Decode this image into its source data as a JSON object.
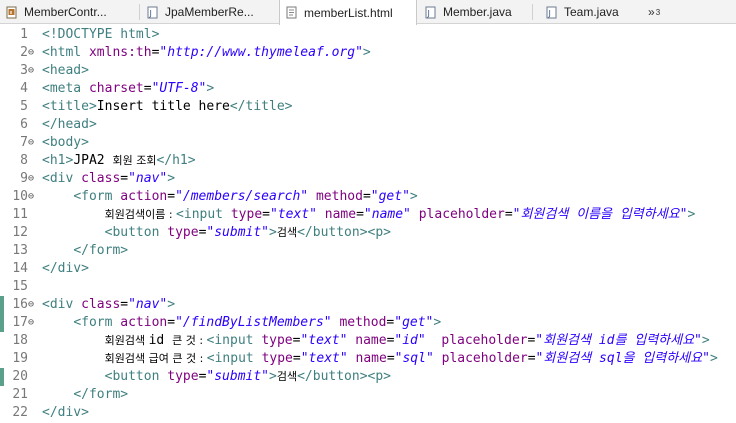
{
  "tabs": [
    {
      "label": "MemberContr...",
      "icon": "java-class-icon",
      "active": false
    },
    {
      "label": "JpaMemberRe...",
      "icon": "java-file-icon",
      "active": false
    },
    {
      "label": "memberList.html",
      "icon": "html-file-icon",
      "active": true
    },
    {
      "label": "Member.java",
      "icon": "java-file-icon",
      "active": false
    },
    {
      "label": "Team.java",
      "icon": "java-file-icon",
      "active": false
    }
  ],
  "overflow": {
    "symbol": "»",
    "count": "3"
  },
  "editor": {
    "lines": [
      {
        "n": "1",
        "fold": "",
        "mark": false,
        "segs": [
          [
            "tg",
            "<!DOCTYPE html>"
          ]
        ]
      },
      {
        "n": "2",
        "fold": "⊖",
        "mark": false,
        "segs": [
          [
            "tg",
            "<html "
          ],
          [
            "at",
            "xmlns:th"
          ],
          [
            "tx",
            "="
          ],
          [
            "av",
            "\"http://www.thymeleaf.org\""
          ],
          [
            "tg",
            ">"
          ]
        ]
      },
      {
        "n": "3",
        "fold": "⊖",
        "mark": false,
        "segs": [
          [
            "tg",
            "<head>"
          ]
        ]
      },
      {
        "n": "4",
        "fold": "",
        "mark": false,
        "segs": [
          [
            "tg",
            "<meta "
          ],
          [
            "at",
            "charset"
          ],
          [
            "tx",
            "="
          ],
          [
            "av",
            "\"UTF-8\""
          ],
          [
            "tg",
            ">"
          ]
        ]
      },
      {
        "n": "5",
        "fold": "",
        "mark": false,
        "segs": [
          [
            "tg",
            "<title>"
          ],
          [
            "tx",
            "Insert title here"
          ],
          [
            "tg",
            "</title>"
          ]
        ]
      },
      {
        "n": "6",
        "fold": "",
        "mark": false,
        "segs": [
          [
            "tg",
            "</head>"
          ]
        ]
      },
      {
        "n": "7",
        "fold": "⊖",
        "mark": false,
        "segs": [
          [
            "tg",
            "<body>"
          ]
        ]
      },
      {
        "n": "8",
        "fold": "",
        "mark": false,
        "segs": [
          [
            "tg",
            "<h1>"
          ],
          [
            "tx",
            "JPA2 "
          ],
          [
            "kr",
            "회원 조회"
          ],
          [
            "tg",
            "</h1>"
          ]
        ]
      },
      {
        "n": "9",
        "fold": "⊖",
        "mark": false,
        "segs": [
          [
            "tg",
            "<div "
          ],
          [
            "at",
            "class"
          ],
          [
            "tx",
            "="
          ],
          [
            "av",
            "\"nav\""
          ],
          [
            "tg",
            ">"
          ]
        ]
      },
      {
        "n": "10",
        "fold": "⊖",
        "mark": false,
        "segs": [
          [
            "tx",
            "    "
          ],
          [
            "tg",
            "<form "
          ],
          [
            "at",
            "action"
          ],
          [
            "tx",
            "="
          ],
          [
            "av",
            "\"/members/search\""
          ],
          [
            "tx",
            " "
          ],
          [
            "at",
            "method"
          ],
          [
            "tx",
            "="
          ],
          [
            "av",
            "\"get\""
          ],
          [
            "tg",
            ">"
          ]
        ]
      },
      {
        "n": "11",
        "fold": "",
        "mark": false,
        "segs": [
          [
            "tx",
            "        "
          ],
          [
            "kr",
            "회원검색이름 : "
          ],
          [
            "tg",
            "<input "
          ],
          [
            "at",
            "type"
          ],
          [
            "tx",
            "="
          ],
          [
            "av",
            "\"text\""
          ],
          [
            "tx",
            " "
          ],
          [
            "at",
            "name"
          ],
          [
            "tx",
            "="
          ],
          [
            "av",
            "\"name\""
          ],
          [
            "tx",
            " "
          ],
          [
            "at",
            "placeholder"
          ],
          [
            "tx",
            "="
          ],
          [
            "av",
            "\"회원검색 이름을 입력하세요\""
          ],
          [
            "tg",
            ">"
          ]
        ]
      },
      {
        "n": "12",
        "fold": "",
        "mark": false,
        "segs": [
          [
            "tx",
            "        "
          ],
          [
            "tg",
            "<button "
          ],
          [
            "at",
            "type"
          ],
          [
            "tx",
            "="
          ],
          [
            "av",
            "\"submit\""
          ],
          [
            "tg",
            ">"
          ],
          [
            "kr",
            "검색"
          ],
          [
            "tg",
            "</button><p>"
          ]
        ]
      },
      {
        "n": "13",
        "fold": "",
        "mark": false,
        "segs": [
          [
            "tx",
            "    "
          ],
          [
            "tg",
            "</form>"
          ]
        ]
      },
      {
        "n": "14",
        "fold": "",
        "mark": false,
        "segs": [
          [
            "tg",
            "</div>"
          ]
        ]
      },
      {
        "n": "15",
        "fold": "",
        "mark": false,
        "segs": []
      },
      {
        "n": "16",
        "fold": "⊖",
        "mark": true,
        "segs": [
          [
            "tg",
            "<div "
          ],
          [
            "at",
            "class"
          ],
          [
            "tx",
            "="
          ],
          [
            "av",
            "\"nav\""
          ],
          [
            "tg",
            ">"
          ]
        ]
      },
      {
        "n": "17",
        "fold": "⊖",
        "mark": true,
        "segs": [
          [
            "tx",
            "    "
          ],
          [
            "tg",
            "<form "
          ],
          [
            "at",
            "action"
          ],
          [
            "tx",
            "="
          ],
          [
            "av",
            "\"/findByListMembers\""
          ],
          [
            "tx",
            " "
          ],
          [
            "at",
            "method"
          ],
          [
            "tx",
            "="
          ],
          [
            "av",
            "\"get\""
          ],
          [
            "tg",
            ">"
          ]
        ]
      },
      {
        "n": "18",
        "fold": "",
        "mark": false,
        "segs": [
          [
            "tx",
            "        "
          ],
          [
            "kr",
            "회원검색 "
          ],
          [
            "tx",
            "id "
          ],
          [
            "kr",
            "큰 것 : "
          ],
          [
            "tg",
            "<input "
          ],
          [
            "at",
            "type"
          ],
          [
            "tx",
            "="
          ],
          [
            "av",
            "\"text\""
          ],
          [
            "tx",
            " "
          ],
          [
            "at",
            "name"
          ],
          [
            "tx",
            "="
          ],
          [
            "av",
            "\"id\""
          ],
          [
            "tx",
            "  "
          ],
          [
            "at",
            "placeholder"
          ],
          [
            "tx",
            "="
          ],
          [
            "av",
            "\"회원검색 id를 입력하세요\""
          ],
          [
            "tg",
            ">"
          ]
        ]
      },
      {
        "n": "19",
        "fold": "",
        "mark": false,
        "segs": [
          [
            "tx",
            "        "
          ],
          [
            "kr",
            "회원검색 급여 큰 것 : "
          ],
          [
            "tg",
            "<input "
          ],
          [
            "at",
            "type"
          ],
          [
            "tx",
            "="
          ],
          [
            "av",
            "\"text\""
          ],
          [
            "tx",
            " "
          ],
          [
            "at",
            "name"
          ],
          [
            "tx",
            "="
          ],
          [
            "av",
            "\"sql\""
          ],
          [
            "tx",
            " "
          ],
          [
            "at",
            "placeholder"
          ],
          [
            "tx",
            "="
          ],
          [
            "av",
            "\"회원검색 sql을 입력하세요\""
          ],
          [
            "tg",
            ">"
          ]
        ]
      },
      {
        "n": "20",
        "fold": "",
        "mark": true,
        "segs": [
          [
            "tx",
            "        "
          ],
          [
            "tg",
            "<button "
          ],
          [
            "at",
            "type"
          ],
          [
            "tx",
            "="
          ],
          [
            "av",
            "\"submit\""
          ],
          [
            "tg",
            ">"
          ],
          [
            "kr",
            "검색"
          ],
          [
            "tg",
            "</button><p>"
          ]
        ]
      },
      {
        "n": "21",
        "fold": "",
        "mark": false,
        "segs": [
          [
            "tx",
            "    "
          ],
          [
            "tg",
            "</form>"
          ]
        ]
      },
      {
        "n": "22",
        "fold": "",
        "mark": false,
        "segs": [
          [
            "tg",
            "</div>"
          ]
        ]
      }
    ]
  }
}
